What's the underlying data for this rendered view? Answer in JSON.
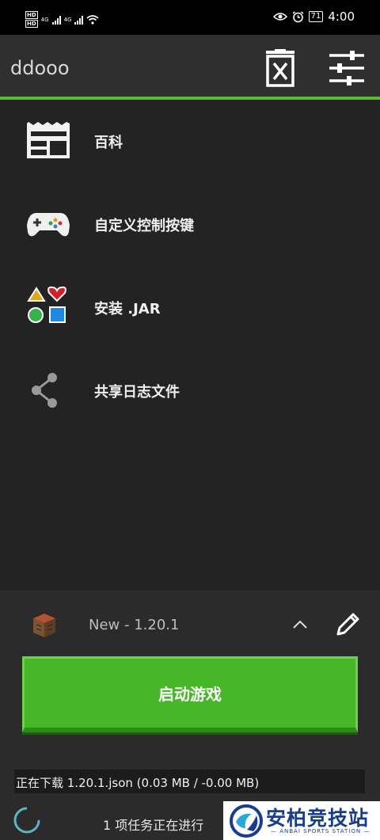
{
  "status_bar": {
    "sim1_badge": "HD",
    "sim2_badge": "HD",
    "net1": "4G",
    "net2": "4G",
    "battery": "71",
    "time": "4:00"
  },
  "app_bar": {
    "title": "ddooo",
    "accent_color": "#57bb38",
    "icons": [
      "trash-icon",
      "tune-icon"
    ]
  },
  "menu": {
    "items": [
      {
        "label": "百科",
        "icon": "news-icon"
      },
      {
        "label": "自定义控制按键",
        "icon": "gamepad-icon"
      },
      {
        "label": "安装 .JAR",
        "icon": "shapes-icon"
      },
      {
        "label": "共享日志文件",
        "icon": "share-icon"
      }
    ]
  },
  "profile": {
    "version": "New - 1.20.1",
    "icon": "crafting-table-icon"
  },
  "play_button": {
    "label": "启动游戏",
    "color": "#47b628"
  },
  "download": {
    "text": "正在下载 1.20.1.json (0.03 MB / -0.00 MB)"
  },
  "tasks": {
    "text": "1 项任务正在进行"
  },
  "watermark": {
    "title": "安柏竞技站",
    "subtitle": "— ANBAI SPORTS STATION —"
  }
}
